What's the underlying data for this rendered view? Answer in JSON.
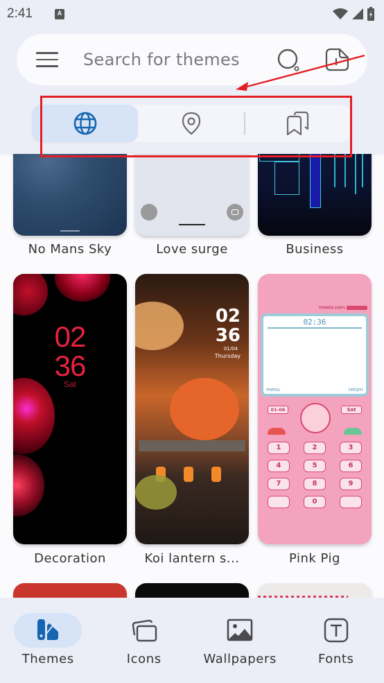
{
  "status_bar": {
    "time": "2:41",
    "notification_icon": "A",
    "icons": [
      "wifi-icon",
      "signal-icon",
      "battery-charging-icon"
    ]
  },
  "search": {
    "placeholder": "Search for themes",
    "value": "",
    "menu_icon": "hamburger-menu-icon",
    "search_icon": "search-icon",
    "import_icon": "import-file-icon"
  },
  "segment_tabs": [
    {
      "name": "global",
      "icon": "globe-icon",
      "active": true
    },
    {
      "name": "local",
      "icon": "location-pin-icon",
      "active": false
    },
    {
      "name": "collections",
      "icon": "bookmarks-icon",
      "active": false
    }
  ],
  "themes": [
    {
      "label": "No Mans Sky"
    },
    {
      "label": "Love surge"
    },
    {
      "label": "Business"
    },
    {
      "label": "Decoration",
      "clock_hours": "02",
      "clock_minutes": "36",
      "clock_day": "Sat"
    },
    {
      "label": "Koi lantern s...",
      "clock_hours": "02",
      "clock_minutes": "36",
      "clock_date": "01/04",
      "clock_day": "Thursday"
    },
    {
      "label": "Pink Pig",
      "screen_time": "02:36",
      "power_text": "POWER:100%",
      "softkey_left": "menu",
      "softkey_right": "return",
      "date": "01-06",
      "day": "Sat",
      "keys": [
        "1",
        "2",
        "3",
        "4",
        "5",
        "6",
        "7",
        "8",
        "9",
        "",
        "0",
        ""
      ]
    },
    {
      "label": ""
    },
    {
      "label": ""
    },
    {
      "label": ""
    }
  ],
  "bottom_nav": [
    {
      "label": "Themes",
      "icon": "themes-palette-icon",
      "active": true
    },
    {
      "label": "Icons",
      "icon": "icons-stack-icon",
      "active": false
    },
    {
      "label": "Wallpapers",
      "icon": "wallpaper-image-icon",
      "active": false
    },
    {
      "label": "Fonts",
      "icon": "font-icon",
      "active": false
    }
  ],
  "colors": {
    "accent": "#1565b0",
    "active_pill": "#d7e3f6",
    "surface": "#ebeef6",
    "annotation": "#e31e24"
  }
}
